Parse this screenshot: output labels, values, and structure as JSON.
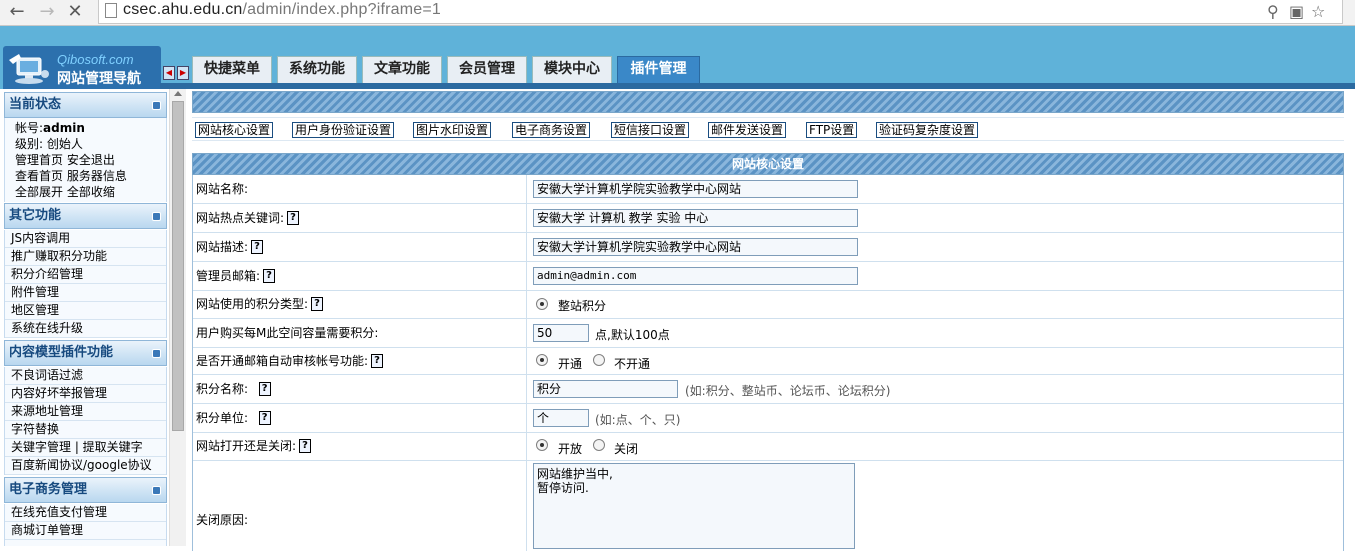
{
  "browser": {
    "back": "←",
    "forward": "→",
    "stop": "✕",
    "url_host": "csec.ahu.edu.cn",
    "url_path": "/admin/index.php?iframe=1"
  },
  "header": {
    "logo_en": "Qibosoft.com",
    "logo_cn": "网站管理导航",
    "tabs": [
      "快捷菜单",
      "系统功能",
      "文章功能",
      "会员管理",
      "模块中心",
      "插件管理"
    ],
    "active_tab": "插件管理"
  },
  "sidebar": {
    "status_title": "当前状态",
    "account_label": "帐号:",
    "account_value": "admin",
    "level_label": "级别:",
    "level_value": "创始人",
    "line3": "管理首页 安全退出",
    "line4": "查看首页 服务器信息",
    "line5": "全部展开 全部收缩",
    "other_title": "其它功能",
    "other_items": [
      "JS内容调用",
      "推广赚取积分功能",
      "积分介绍管理",
      "附件管理",
      "地区管理",
      "系统在线升级"
    ],
    "plugin_title": "内容模型插件功能",
    "plugin_items": [
      "不良词语过滤",
      "内容好坏举报管理",
      "来源地址管理",
      "字符替换",
      "关键字管理 | 提取关键字",
      "百度新闻协议/google协议"
    ],
    "ecom_title": "电子商务管理",
    "ecom_items": [
      "在线充值支付管理",
      "商城订单管理"
    ]
  },
  "main": {
    "links": [
      "网站核心设置",
      "用户身份验证设置",
      "图片水印设置",
      "电子商务设置",
      "短信接口设置",
      "邮件发送设置",
      "FTP设置",
      "验证码复杂度设置"
    ],
    "form_title": "网站核心设置",
    "fields": {
      "site_name_label": "网站名称:",
      "site_name_value": "安徽大学计算机学院实验教学中心网站",
      "keywords_label": "网站热点关键词:",
      "keywords_value": "安徽大学 计算机 教学 实验 中心",
      "desc_label": "网站描述:",
      "desc_value": "安徽大学计算机学院实验教学中心网站",
      "email_label": "管理员邮箱:",
      "email_value": "admin@admin.com",
      "points_type_label": "网站使用的积分类型:",
      "points_type_option": "整站积分",
      "space_label": "用户购买每M此空间容量需要积分:",
      "space_value": "50",
      "space_hint": "点,默认100点",
      "email_audit_label": "是否开通邮箱自动审核帐号功能:",
      "email_audit_on": "开通",
      "email_audit_off": "不开通",
      "points_name_label": "积分名称:",
      "points_name_value": "积分",
      "points_name_hint": "(如:积分、整站币、论坛币、论坛积分)",
      "points_unit_label": "积分单位:",
      "points_unit_value": "个",
      "points_unit_hint": "(如:点、个、只)",
      "site_open_label": "网站打开还是关闭:",
      "site_open_on": "开放",
      "site_open_off": "关闭",
      "close_reason_label": "关闭原因:",
      "close_reason_value": "网站维护当中,\n暂停访问."
    }
  }
}
